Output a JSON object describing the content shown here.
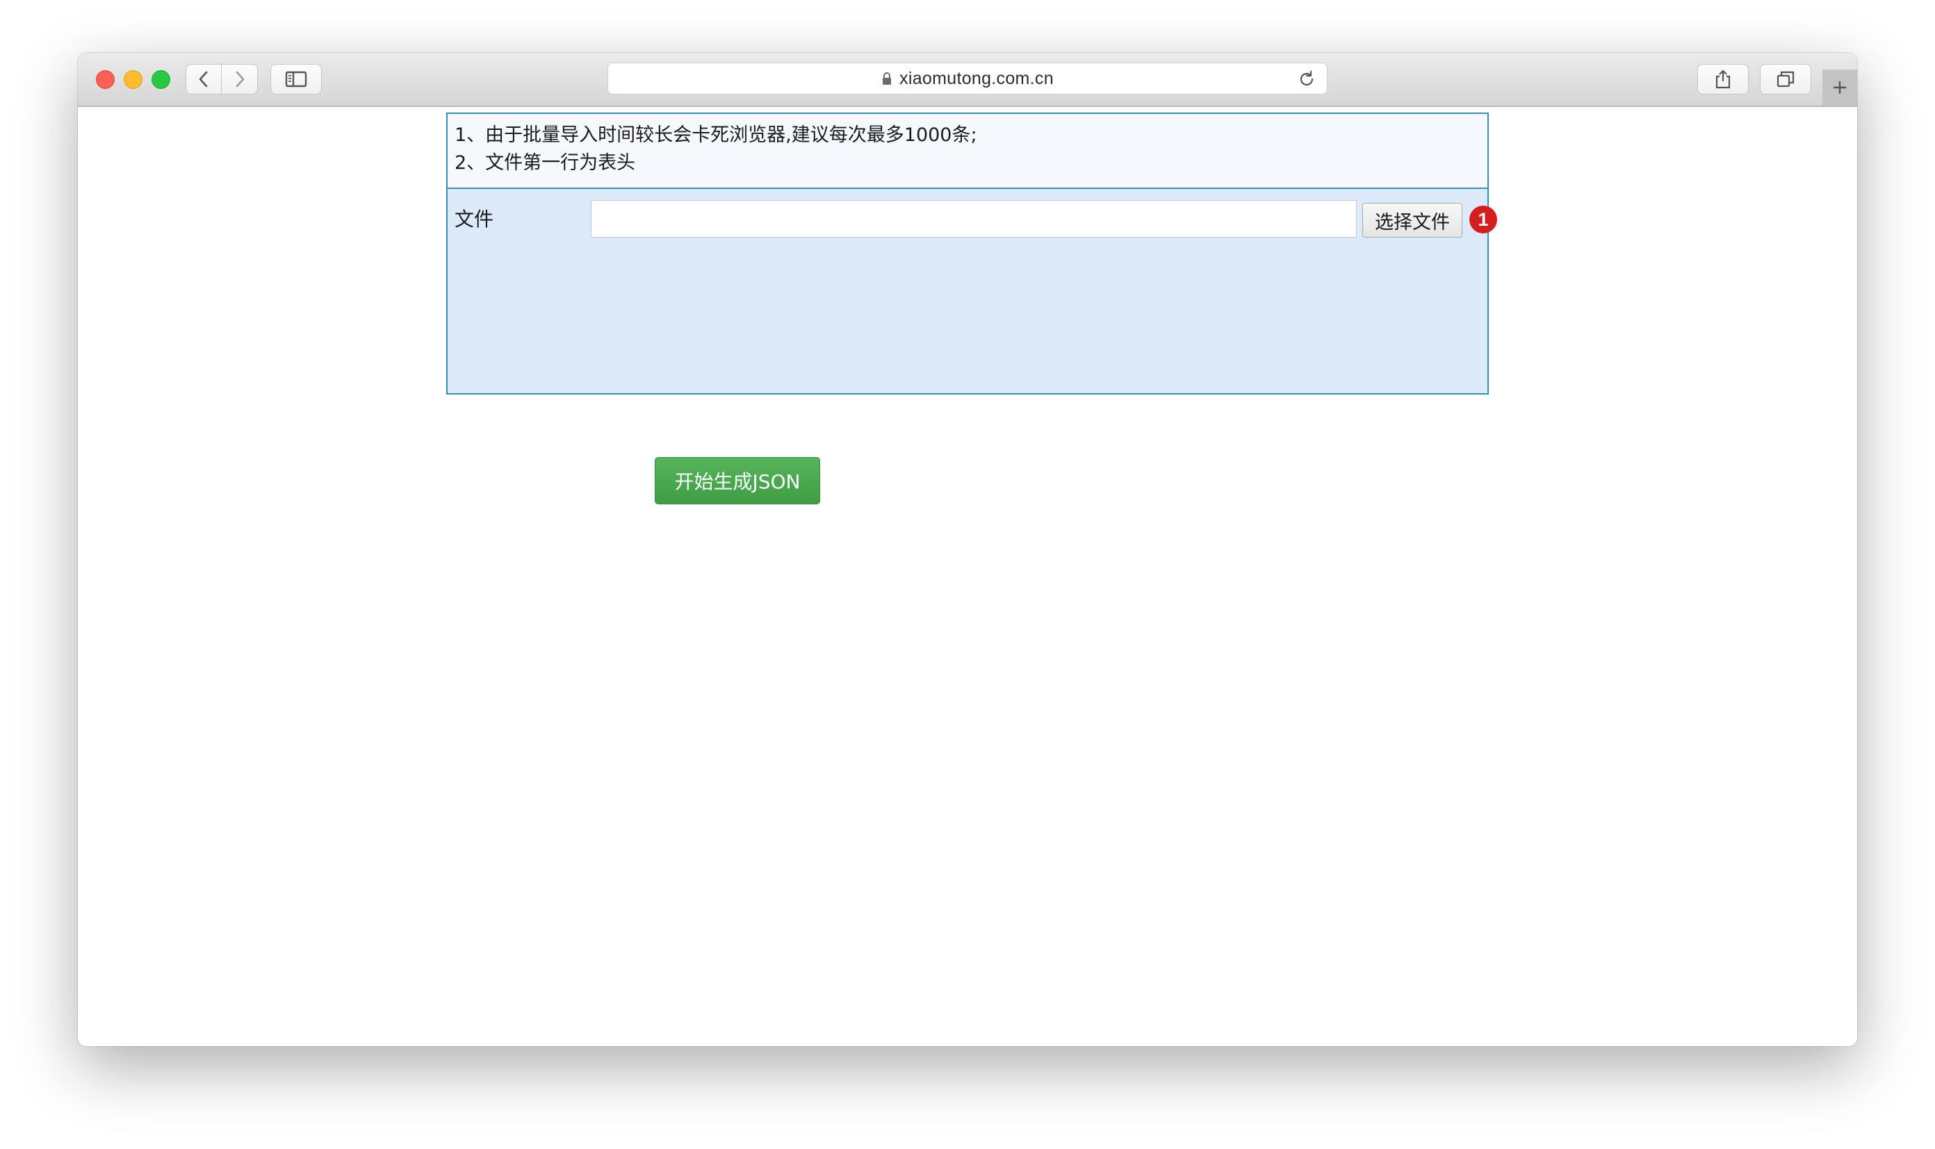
{
  "browser": {
    "url": "xiaomutong.com.cn",
    "icons": {
      "back": "chevron-left-icon",
      "forward": "chevron-right-icon",
      "sidebar": "sidebar-icon",
      "lock": "lock-icon",
      "reload": "reload-icon",
      "share": "share-icon",
      "tabs": "tabs-overview-icon",
      "new_tab": "plus-icon"
    }
  },
  "import_form": {
    "tips": [
      "1、由于批量导入时间较长会卡死浏览器,建议每次最多1000条;",
      "2、文件第一行为表头"
    ],
    "file_label": "文件",
    "file_value": "",
    "choose_button": "选择文件",
    "badge": "1",
    "submit_button": "开始生成JSON"
  },
  "colors": {
    "panel_border": "#3a8fb6",
    "panel_bg": "#dbe9f8",
    "submit_green": "#47a64c",
    "badge_red": "#d41e1e"
  }
}
